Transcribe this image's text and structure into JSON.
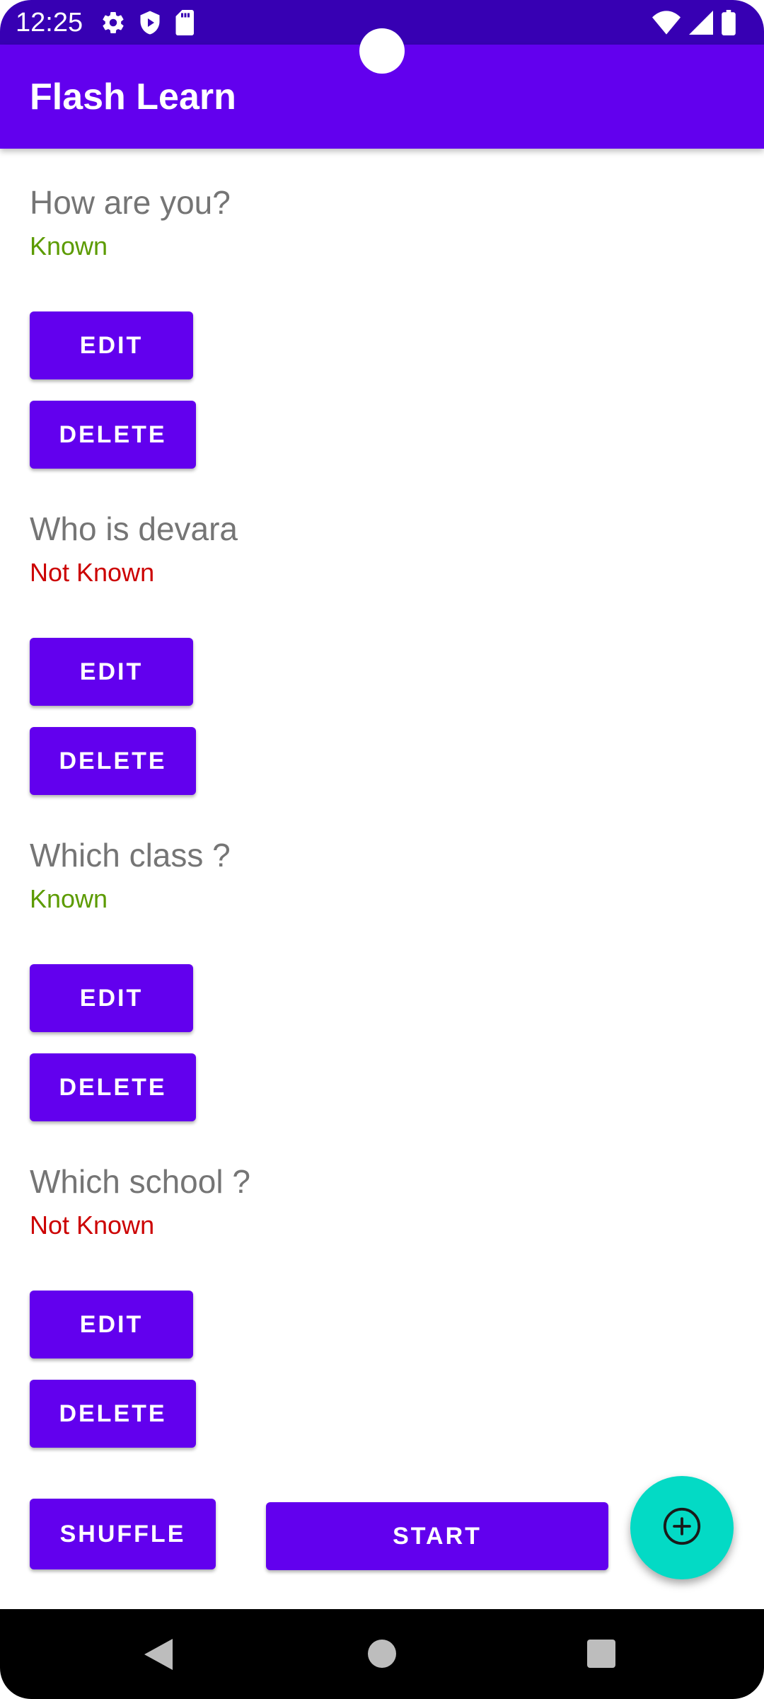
{
  "status_bar": {
    "time": "12:25",
    "left_icons": [
      "gear-icon",
      "shield-play-icon",
      "sd-card-icon"
    ],
    "right_icons": [
      "wifi-icon",
      "signal-icon",
      "battery-icon"
    ]
  },
  "app_bar": {
    "title": "Flash Learn"
  },
  "cards": [
    {
      "question": "How are you?",
      "status": "Known",
      "status_color": "#5C9B00",
      "edit_label": "EDIT",
      "delete_label": "DELETE"
    },
    {
      "question": "Who is devara",
      "status": "Not Known",
      "status_color": "#CC0000",
      "edit_label": "EDIT",
      "delete_label": "DELETE"
    },
    {
      "question": "Which class ?",
      "status": "Known",
      "status_color": "#5C9B00",
      "edit_label": "EDIT",
      "delete_label": "DELETE"
    },
    {
      "question": "Which school ?",
      "status": "Not Known",
      "status_color": "#CC0000",
      "edit_label": "EDIT",
      "delete_label": "DELETE"
    }
  ],
  "actions": {
    "shuffle_label": "SHUFFLE",
    "start_label": "START",
    "fab_icon": "add-circle-icon"
  },
  "colors": {
    "primary": "#6200EE",
    "primary_dark": "#3700B3",
    "accent": "#03DAC5",
    "known": "#5C9B00",
    "not_known": "#CC0000"
  },
  "nav_bar": {
    "icons": [
      "back-icon",
      "home-icon",
      "recents-icon"
    ]
  }
}
